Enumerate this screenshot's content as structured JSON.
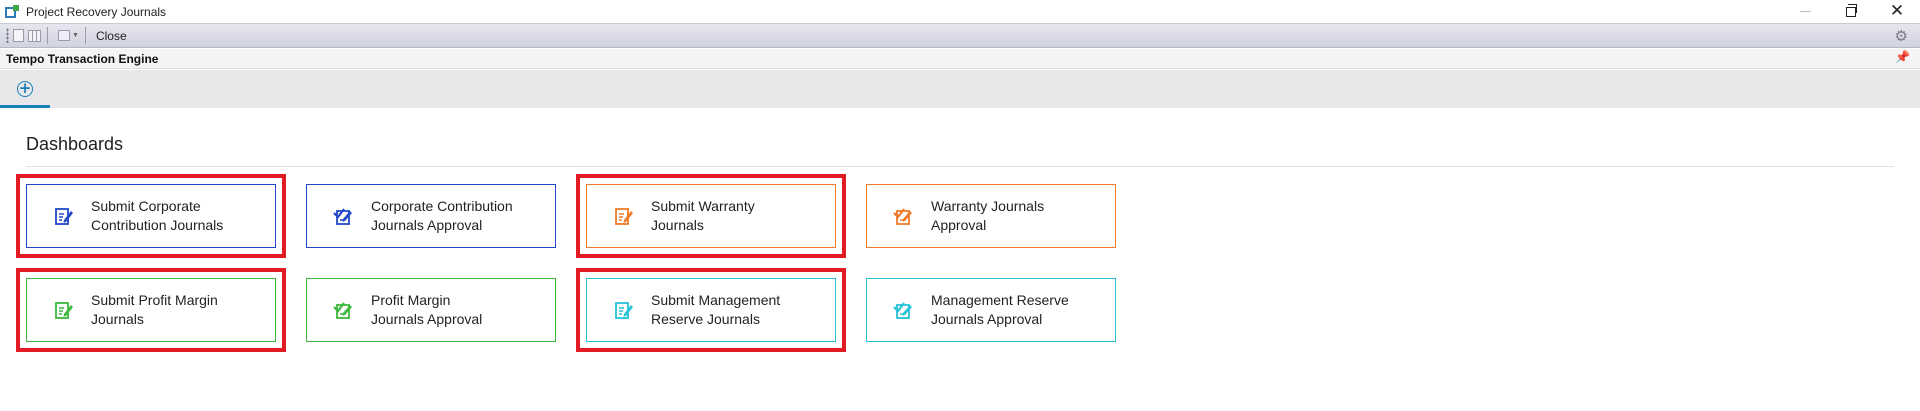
{
  "window": {
    "title": "Project Recovery Journals"
  },
  "toolbar": {
    "close_label": "Close"
  },
  "engine": {
    "title": "Tempo Transaction Engine"
  },
  "dashboards": {
    "heading": "Dashboards",
    "tiles": [
      {
        "label": "Submit Corporate\nContribution Journals",
        "color": "#2348c8",
        "icon": "edit-document-icon",
        "highlighted": true
      },
      {
        "label": "Corporate Contribution\nJournals Approval",
        "color": "#2348c8",
        "icon": "approval-check-icon",
        "highlighted": false
      },
      {
        "label": "Submit Warranty\nJournals",
        "color": "#f07a2a",
        "icon": "edit-document-icon",
        "highlighted": true
      },
      {
        "label": "Warranty Journals\nApproval",
        "color": "#f07a2a",
        "icon": "approval-check-icon",
        "highlighted": false
      },
      {
        "label": "Submit Profit Margin\nJournals",
        "color": "#3cb83a",
        "icon": "edit-document-icon",
        "highlighted": true
      },
      {
        "label": "Profit Margin\nJournals Approval",
        "color": "#3cb83a",
        "icon": "approval-check-icon",
        "highlighted": false
      },
      {
        "label": "Submit Management\nReserve Journals",
        "color": "#26c2d6",
        "icon": "edit-document-icon",
        "highlighted": true
      },
      {
        "label": "Management Reserve\nJournals Approval",
        "color": "#26c2d6",
        "icon": "approval-check-icon",
        "highlighted": false
      }
    ]
  },
  "highlight_color": "#e01b24"
}
